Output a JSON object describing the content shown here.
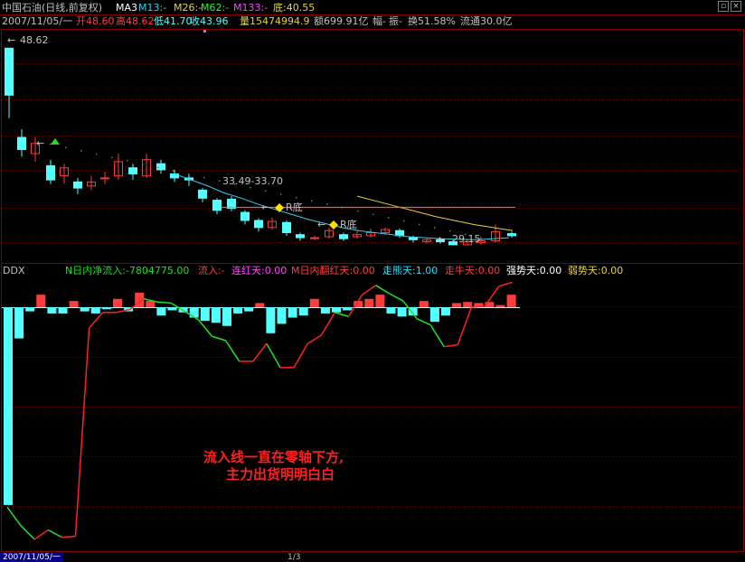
{
  "title": {
    "stock": "中国石油(日线,前复权)",
    "ma_label": "MA3",
    "m13": "M13:-",
    "m26": "M26:-",
    "m62": "M62:-",
    "m133": "M133:-",
    "low": "底:40.55",
    "restore_icon": "restore-icon",
    "close_icon": "close-icon"
  },
  "info": {
    "date": "2007/11/05/一",
    "open": "开48.60",
    "high": "高48.62",
    "low": "低41.70",
    "close": "收43.96",
    "volume": "量1547499 4.9",
    "volume_text": "量15474994.9",
    "amount": "额699.91亿",
    "amp": "幅-",
    "zhen": "振-",
    "turnover": "换51.58%",
    "float": "流通30.0亿"
  },
  "price_labels": {
    "high_mark": "48.62",
    "range_mark": "33.49-33.70",
    "r_bottom_1": "R底",
    "r_bottom_2": "R底",
    "low_mark": "29.15"
  },
  "ddx": {
    "name": "DDX",
    "n_inflow": "N日内净流入:-7804775.00",
    "inflow": "流入:-",
    "red_days": "连红天:0.00",
    "m_red_days": "M日内翻红天:0.00",
    "strong_days": "走熊天:1.00",
    "bull_days": "走牛天:0.00",
    "strong_trend": "强势天:0.00",
    "weak_trend": "弱势天:0.00"
  },
  "annotation": {
    "line1": "流入线一直在零轴下方,",
    "line2": "主力出货明明白白"
  },
  "footer": {
    "date": "2007/11/05/一",
    "page": "1/3"
  },
  "colors": {
    "up": "#ff3c3c",
    "down": "#54ffff",
    "ma_cyan": "#40c8e8",
    "ma_yellow": "#e6d23c",
    "flow_green": "#20e020",
    "flow_red": "#ff2020",
    "grid": "#800000"
  },
  "chart_data": [
    {
      "type": "candlestick",
      "title": "中国石油(日线,前复权)",
      "candles": [
        {
          "o": 48.6,
          "c": 43.96,
          "h": 48.62,
          "l": 41.7
        },
        {
          "o": 39.8,
          "c": 38.6,
          "h": 40.6,
          "l": 37.9
        },
        {
          "o": 38.2,
          "c": 39.2,
          "h": 39.8,
          "l": 37.4
        },
        {
          "o": 37.0,
          "c": 35.6,
          "h": 37.6,
          "l": 35.2
        },
        {
          "o": 36.0,
          "c": 36.8,
          "h": 37.2,
          "l": 35.2
        },
        {
          "o": 35.4,
          "c": 34.8,
          "h": 35.8,
          "l": 34.2
        },
        {
          "o": 35.0,
          "c": 35.4,
          "h": 36.0,
          "l": 34.6
        },
        {
          "o": 35.8,
          "c": 35.8,
          "h": 36.4,
          "l": 35.2
        },
        {
          "o": 36.0,
          "c": 37.4,
          "h": 38.2,
          "l": 35.6
        },
        {
          "o": 36.8,
          "c": 36.2,
          "h": 37.2,
          "l": 35.6
        },
        {
          "o": 36.0,
          "c": 37.6,
          "h": 38.2,
          "l": 35.8
        },
        {
          "o": 37.2,
          "c": 36.6,
          "h": 37.6,
          "l": 36.2
        },
        {
          "o": 36.2,
          "c": 35.8,
          "h": 36.6,
          "l": 35.4
        },
        {
          "o": 35.8,
          "c": 35.6,
          "h": 36.2,
          "l": 35.0
        },
        {
          "o": 34.6,
          "c": 33.8,
          "h": 34.8,
          "l": 33.4
        },
        {
          "o": 33.6,
          "c": 32.6,
          "h": 33.8,
          "l": 32.2
        },
        {
          "o": 33.7,
          "c": 32.8,
          "h": 34.0,
          "l": 32.5
        },
        {
          "o": 32.4,
          "c": 31.6,
          "h": 32.6,
          "l": 31.2
        },
        {
          "o": 31.6,
          "c": 30.9,
          "h": 31.8,
          "l": 30.5
        },
        {
          "o": 30.9,
          "c": 31.5,
          "h": 31.9,
          "l": 30.7
        },
        {
          "o": 31.4,
          "c": 30.4,
          "h": 31.6,
          "l": 30.1
        },
        {
          "o": 30.2,
          "c": 29.9,
          "h": 30.4,
          "l": 29.6
        },
        {
          "o": 29.9,
          "c": 29.9,
          "h": 30.1,
          "l": 29.7
        },
        {
          "o": 30.0,
          "c": 30.6,
          "h": 30.9,
          "l": 29.8
        },
        {
          "o": 30.2,
          "c": 29.8,
          "h": 30.4,
          "l": 29.6
        },
        {
          "o": 30.0,
          "c": 30.2,
          "h": 30.6,
          "l": 29.8
        },
        {
          "o": 30.1,
          "c": 30.4,
          "h": 30.8,
          "l": 29.9
        },
        {
          "o": 30.4,
          "c": 30.7,
          "h": 30.9,
          "l": 30.2
        },
        {
          "o": 30.6,
          "c": 30.1,
          "h": 30.8,
          "l": 29.9
        },
        {
          "o": 29.9,
          "c": 29.7,
          "h": 30.1,
          "l": 29.4
        },
        {
          "o": 29.5,
          "c": 29.7,
          "h": 29.9,
          "l": 29.3
        },
        {
          "o": 29.7,
          "c": 29.5,
          "h": 29.9,
          "l": 29.3
        },
        {
          "o": 29.5,
          "c": 29.2,
          "h": 29.7,
          "l": 29.15
        },
        {
          "o": 29.2,
          "c": 29.5,
          "h": 29.8,
          "l": 29.15
        },
        {
          "o": 29.4,
          "c": 29.6,
          "h": 29.9,
          "l": 29.2
        },
        {
          "o": 29.6,
          "c": 30.5,
          "h": 31.2,
          "l": 29.4
        },
        {
          "o": 30.3,
          "c": 30.1,
          "h": 30.5,
          "l": 29.9
        }
      ],
      "ma_cyan": [
        36.2,
        35.6,
        35.0,
        34.3,
        33.8,
        33.2,
        32.7,
        32.2,
        31.7,
        31.3,
        30.9,
        30.6,
        30.4,
        30.2,
        30.0,
        29.9,
        29.8,
        29.75,
        29.7,
        29.8,
        29.9
      ],
      "ma_yellow": [
        34.0,
        33.5,
        33.0,
        32.5,
        32.0,
        31.6,
        31.2,
        30.9,
        30.6
      ],
      "hline": 32.9,
      "ylim": [
        27.5,
        50.5
      ]
    },
    {
      "type": "bar+line",
      "title": "DDX",
      "bars": [
        -19.0,
        -3.0,
        -0.4,
        1.2,
        -0.6,
        -0.6,
        0.6,
        -0.4,
        -0.6,
        -0.2,
        0.8,
        -0.4,
        1.4,
        0.6,
        -0.8,
        -0.3,
        -0.5,
        -1.0,
        -1.3,
        -1.5,
        -1.8,
        -0.6,
        -0.4,
        0.4,
        -2.5,
        -1.6,
        -1.0,
        -0.8,
        0.8,
        -0.6,
        -0.5,
        -0.3,
        0.6,
        0.8,
        1.2,
        -0.6,
        -0.9,
        -0.8,
        0.6,
        -1.4,
        -0.8,
        0.4,
        0.5,
        0.4,
        0.5,
        0.2,
        1.2
      ],
      "flow": [
        -19.2,
        -21.0,
        -22.3,
        -21.4,
        -22.1,
        -22.0,
        -2.0,
        -0.5,
        -0.5,
        -0.2,
        0.8,
        0.5,
        0.4,
        -0.4,
        -1.2,
        -2.8,
        -3.2,
        -5.2,
        -5.2,
        -3.5,
        -5.8,
        -5.8,
        -3.5,
        -2.7,
        -0.5,
        -0.9,
        1.2,
        2.1,
        1.3,
        0.6,
        -1.1,
        -1.7,
        -3.8,
        -3.6,
        0.0,
        0.1,
        2.0,
        2.4
      ],
      "ylim": [
        -23,
        3
      ]
    }
  ]
}
